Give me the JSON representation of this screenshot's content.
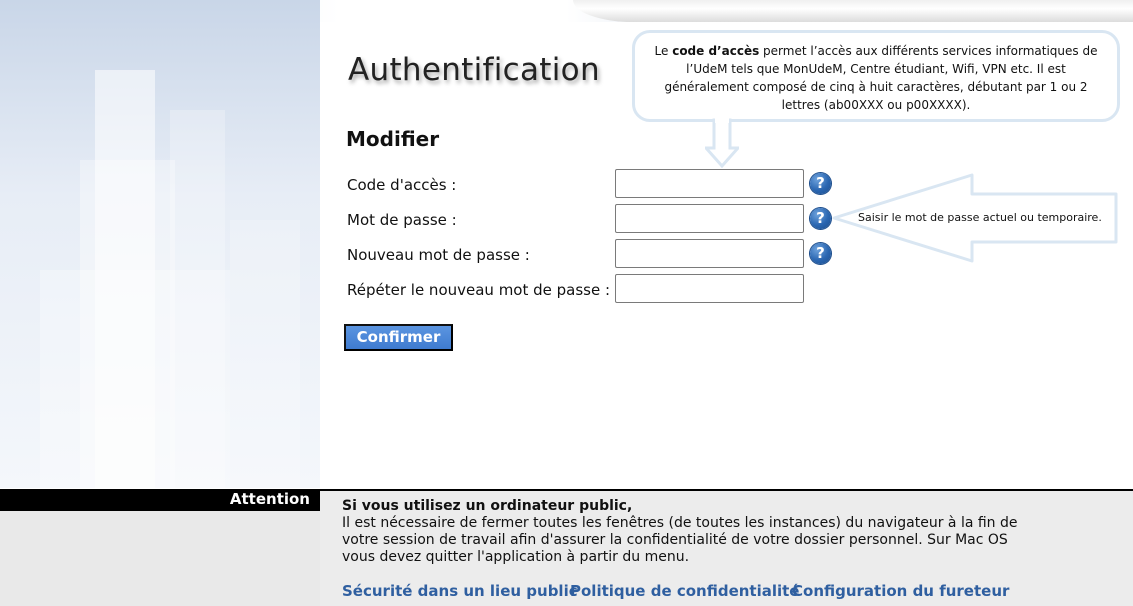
{
  "header": {
    "page_title": "Authentification",
    "section_title": "Modifier"
  },
  "form": {
    "fields": [
      {
        "label": "Code d'accès :",
        "value": "",
        "has_help": true
      },
      {
        "label": "Mot de passe :",
        "value": "",
        "has_help": true
      },
      {
        "label": "Nouveau mot de passe :",
        "value": "",
        "has_help": true
      },
      {
        "label": "Répéter le nouveau mot de passe :",
        "value": "",
        "has_help": false
      }
    ],
    "confirm_label": "Confirmer",
    "help_glyph": "?"
  },
  "callouts": {
    "code_acces": {
      "text_before": "Le ",
      "bold": "code d’accès",
      "text_after": " permet l’accès aux différents services informatiques de l’UdeM tels que MonUdeM, Centre étudiant, Wifi, VPN etc.  Il est généralement composé de cinq à huit caractères, débutant par 1 ou 2 lettres (ab00XXX ou p00XXXX)."
    },
    "mot_de_passe": "Saisir le mot de passe actuel ou temporaire."
  },
  "attention": {
    "title": "Attention",
    "heading": "Si vous utilisez un ordinateur public,",
    "body": "Il est nécessaire de fermer toutes les fenêtres (de toutes les instances) du navigateur à la fin de votre session de travail afin d'assurer la confidentialité de votre dossier personnel. Sur Mac OS vous devez quitter l'application à partir du menu."
  },
  "footer": {
    "links": [
      "Sécurité dans un lieu public",
      "Politique de confidentialité",
      "Configuration du fureteur"
    ]
  },
  "colors": {
    "button_blue": "#4a86d8",
    "link_blue": "#2f5fa0",
    "help_icon_blue": "#2a66b1",
    "callout_border": "#d9e6f2"
  }
}
